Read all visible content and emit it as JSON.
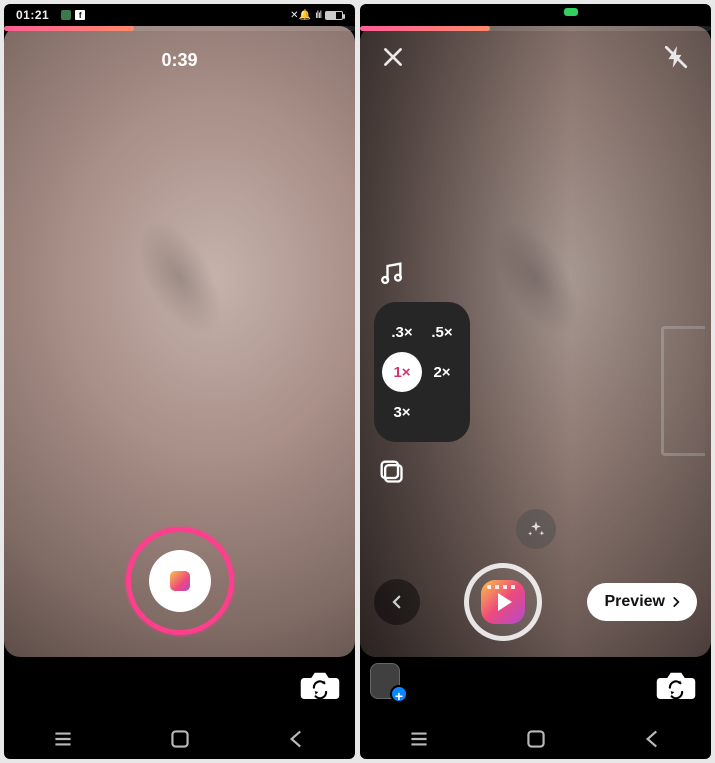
{
  "statusbar": {
    "time": "01:21",
    "fb_glyph": "f"
  },
  "left": {
    "progress_pct": 37,
    "timer": "0:39"
  },
  "right": {
    "progress_pct": 37,
    "speed_options": {
      "a": ".3×",
      "b": ".5×",
      "c": "1×",
      "d": "2×",
      "e": "3×"
    },
    "preview_label": "Preview"
  }
}
